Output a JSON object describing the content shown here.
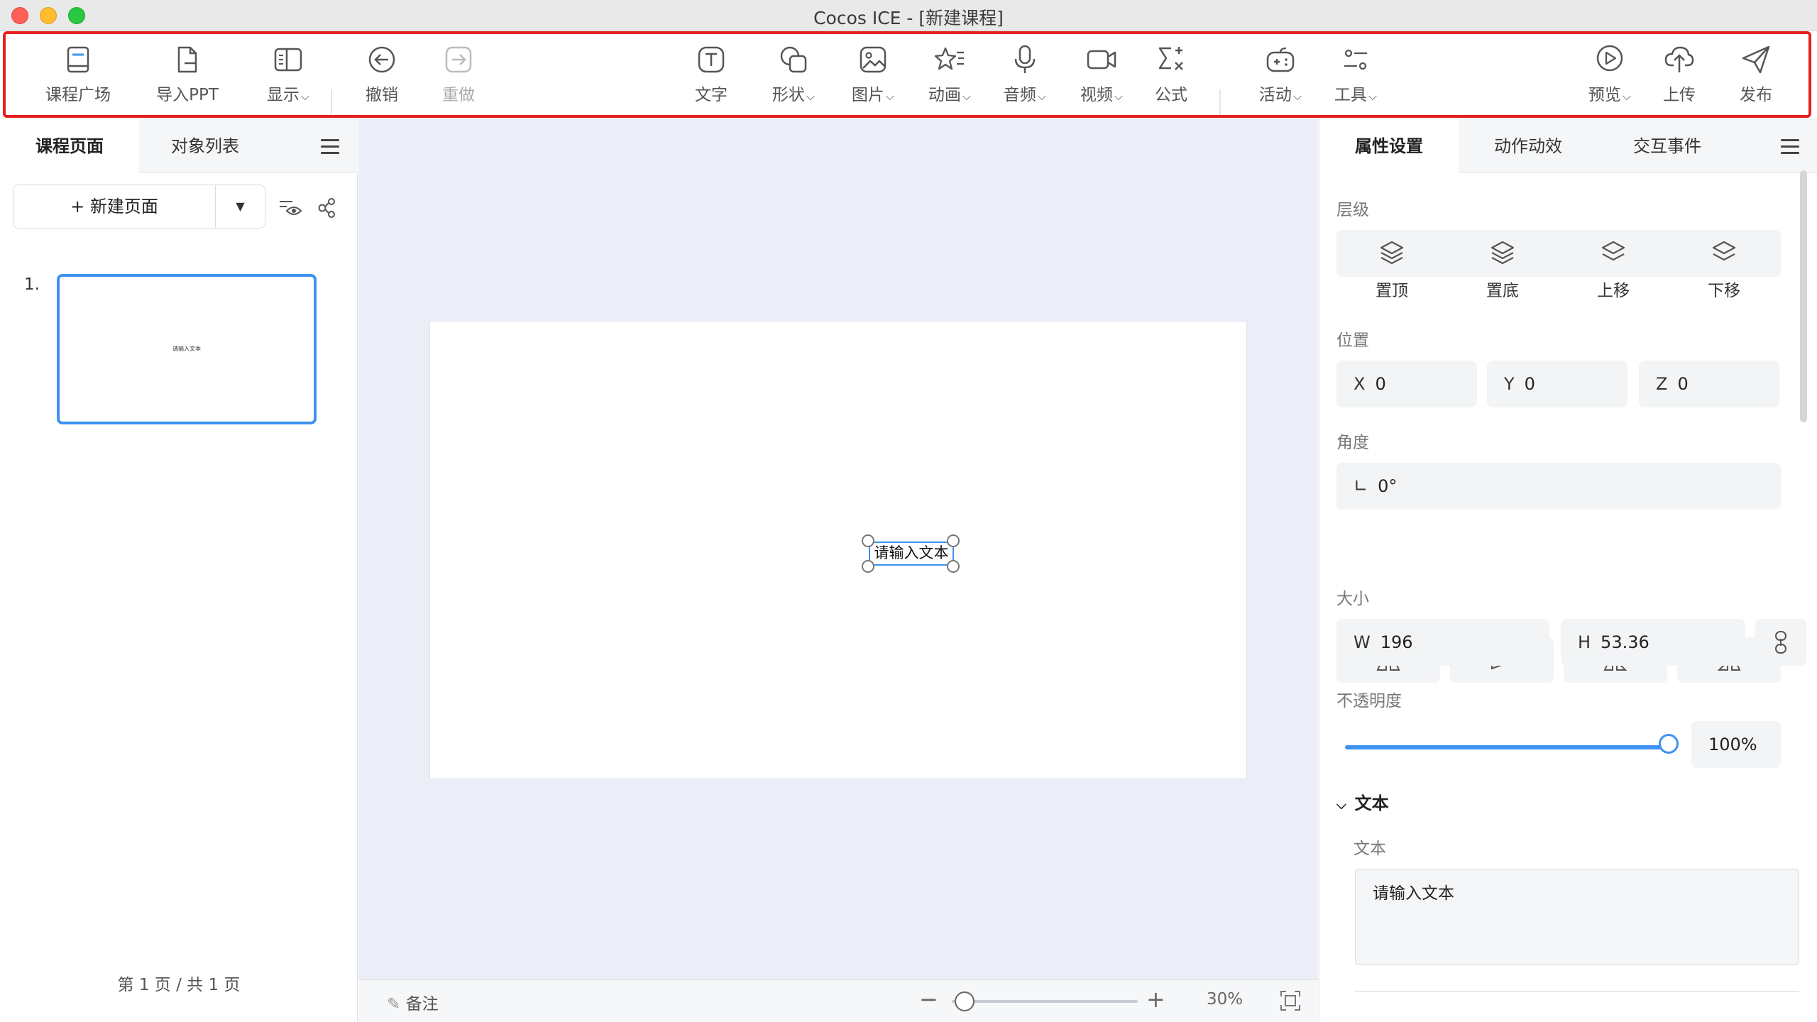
{
  "window": {
    "title": "Cocos ICE - [新建课程]"
  },
  "toolbar": {
    "course_square": "课程广场",
    "import_ppt": "导入PPT",
    "display": "显示",
    "undo": "撤销",
    "redo": "重做",
    "text": "文字",
    "shape": "形状",
    "image": "图片",
    "animation": "动画",
    "audio": "音频",
    "video": "视频",
    "formula": "公式",
    "activity": "活动",
    "tools": "工具",
    "preview": "预览",
    "upload": "上传",
    "publish": "发布"
  },
  "left_panel": {
    "tabs": [
      "课程页面",
      "对象列表"
    ],
    "new_page": "新建页面",
    "pages": [
      {
        "number": "1.",
        "thumb_text": "请输入文本"
      }
    ],
    "page_info": "第 1 页 / 共 1 页"
  },
  "canvas": {
    "text_element": "请输入文本"
  },
  "bottom_bar": {
    "remark": "备注",
    "zoom": "30%",
    "zoom_level": 0.3
  },
  "right_panel": {
    "tabs": [
      "属性设置",
      "动作动效",
      "交互事件"
    ],
    "layer": {
      "label": "层级",
      "buttons": [
        "置顶",
        "置底",
        "上移",
        "下移"
      ]
    },
    "position": {
      "label": "位置",
      "x_key": "X",
      "x": "0",
      "y_key": "Y",
      "y": "0",
      "z_key": "Z",
      "z": "0"
    },
    "angle": {
      "label": "角度",
      "value": "0°"
    },
    "size": {
      "label": "大小",
      "w_key": "W",
      "w": "196",
      "h_key": "H",
      "h": "53.36"
    },
    "opacity": {
      "label": "不透明度",
      "value": "100%",
      "level": 1.0
    },
    "text_section": {
      "header": "文本",
      "label": "文本",
      "value": "请输入文本"
    }
  },
  "colors": {
    "accent": "#3d92f2",
    "highlight_border": "#e61f1f",
    "canvas_bg": "#ebeef6"
  }
}
